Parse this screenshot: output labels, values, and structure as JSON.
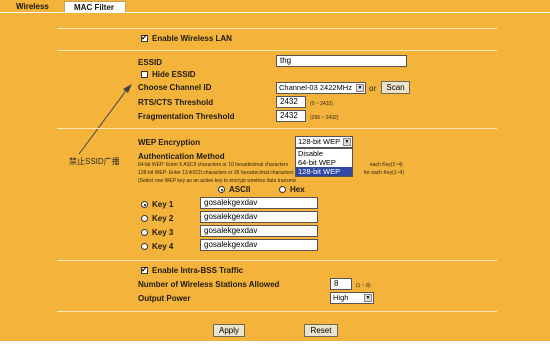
{
  "tabs": {
    "wireless": "Wireless",
    "mac_filter": "MAC Filter"
  },
  "wlan": {
    "enable_label": "Enable Wireless LAN",
    "enable_checked": true
  },
  "essid": {
    "label": "ESSID",
    "value": "thg",
    "hide_label": "Hide ESSID",
    "hide_checked": false
  },
  "channel": {
    "label": "Choose Channel ID",
    "value": "Channel-03 2422MHz",
    "or_text": "or",
    "scan_label": "Scan"
  },
  "rts": {
    "label": "RTS/CTS Threshold",
    "value": "2432",
    "range": "(0 ~ 2432)"
  },
  "frag": {
    "label": "Fragmentation Threshold",
    "value": "2432",
    "range": "(256 ~ 2432)"
  },
  "annotation": {
    "text": "禁止SSID广播"
  },
  "wep": {
    "label": "WEP Encryption",
    "value": "128-bit WEP",
    "options": [
      "Disable",
      "64-bit WEP",
      "128-bit WEP"
    ],
    "selected_index": 2,
    "auth_label": "Authentication Method",
    "help_line1": "64-bit WEP: Enter 5 ASCII characters or 10 hexadecimal characters",
    "help_line1_tail": "each Key(1~4)",
    "help_line2": "128-bit WEP: Enter 13 ASCII characters or 26 hexadecimal characters",
    "help_line2_tail": "for each Key(1~4)",
    "help_line3": "(Select one WEP key as an active key to encrypt wireless data transmission.)",
    "ascii_label": "ASCII",
    "hex_label": "Hex",
    "ascii_selected": true
  },
  "keys": [
    {
      "label": "Key 1",
      "value": "gosalekgexdav",
      "selected": true
    },
    {
      "label": "Key 2",
      "value": "gosalekgexdav",
      "selected": false
    },
    {
      "label": "Key 3",
      "value": "gosalekgexdav",
      "selected": false
    },
    {
      "label": "Key 4",
      "value": "gosalekgexdav",
      "selected": false
    }
  ],
  "intra_bss": {
    "label": "Enable Intra-BSS Traffic",
    "checked": true
  },
  "stations": {
    "label": "Number of Wireless Stations Allowed",
    "value": "8",
    "range": "(1 ~ 8)"
  },
  "power": {
    "label": "Output Power",
    "value": "High"
  },
  "actions": {
    "apply": "Apply",
    "reset": "Reset"
  }
}
